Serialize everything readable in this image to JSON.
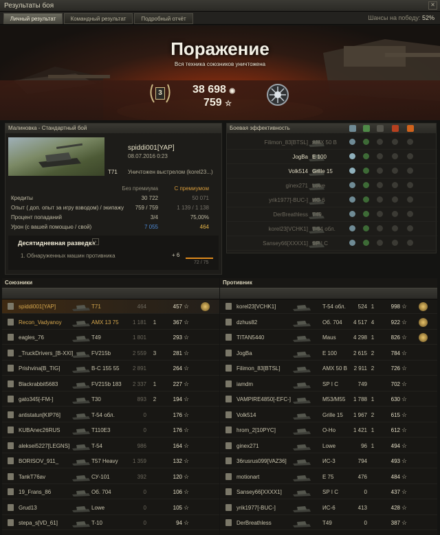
{
  "window": {
    "title": "Результаты боя",
    "close": "×"
  },
  "tabs": [
    {
      "label": "Личный результат",
      "active": true
    },
    {
      "label": "Командный результат",
      "active": false
    },
    {
      "label": "Подробный отчёт",
      "active": false
    }
  ],
  "chance": {
    "label": "Шансы на победу:",
    "value": "52%"
  },
  "banner": {
    "result": "Поражение",
    "subtitle": "Вся техника союзников уничтожена",
    "place": "3",
    "credits": "38 698",
    "xp": "759"
  },
  "battle": {
    "map_mode": "Малиновка - Стандартный бой",
    "player": "spiddi001[YAP]",
    "date": "08.07.2016 0:23",
    "tank": "T71",
    "death": "Уничтожен выстрелом (korel23...)"
  },
  "stats": {
    "col_basic": "Без премиума",
    "col_premium": "С премиумом",
    "rows": [
      {
        "label": "Кредиты",
        "basic": "30 722",
        "premium": "50 071"
      },
      {
        "label": "Опыт (    доп. опыт за игру взводом) / экипажу",
        "basic": "759 / 759",
        "premium": "1 139 / 1 138"
      },
      {
        "label": "Процент попаданий",
        "basic": "3/4",
        "premium": "75,00%"
      },
      {
        "label": "Урон (с вашей помощью / свой)",
        "basic": "7 055",
        "premium": "464"
      }
    ]
  },
  "scouting": {
    "title": "Десятидневная разведка",
    "quest": "1. Обнаруженных машин противника",
    "reward": "+ 6",
    "progress": "72 / 75",
    "progress_fraction": 0.96
  },
  "efficiency": {
    "title": "Боевая эффективность",
    "rows": [
      {
        "name": "Filimon_83[BTSL]",
        "tank": "AMX 50 B",
        "dim": true
      },
      {
        "name": "JogBa",
        "tank": "E 100",
        "dim": false
      },
      {
        "name": "Volk514",
        "tank": "Grille 15",
        "dim": false
      },
      {
        "name": "ginex271",
        "tank": "Lowe",
        "dim": true
      },
      {
        "name": "yrik1977[-BUC-]",
        "tank": "ИС-6",
        "dim": true
      },
      {
        "name": "DerBreathless",
        "tank": "T49",
        "dim": true
      },
      {
        "name": "korel23[VCHK1]",
        "tank": "T-54 обл.",
        "dim": true
      },
      {
        "name": "Sansey66[XXXX1]",
        "tank": "SP I C",
        "dim": true
      }
    ]
  },
  "allies": {
    "title": "Союзники",
    "rows": [
      {
        "name": "spiddi001[YAP]",
        "tank": "T71",
        "dmg": "464",
        "kills": "",
        "xp": "457",
        "me": true
      },
      {
        "name": "Recon_Vadyanoy",
        "tank": "AMX 13 75",
        "dmg": "1 181",
        "kills": "1",
        "xp": "367",
        "yellow": true
      },
      {
        "name": "eagles_76",
        "tank": "T49",
        "dmg": "1 801",
        "kills": "",
        "xp": "293"
      },
      {
        "name": "_TruckDrivers_[B-XXI]",
        "tank": "FV215b",
        "dmg": "2 559",
        "kills": "3",
        "xp": "281"
      },
      {
        "name": "Prishvina[B_TIG]",
        "tank": "B-C 155 55",
        "dmg": "2 891",
        "kills": "",
        "xp": "264"
      },
      {
        "name": "Blackrabbit5683",
        "tank": "FV215b 183",
        "dmg": "2 337",
        "kills": "1",
        "xp": "227"
      },
      {
        "name": "gato345[-FM-]",
        "tank": "T30",
        "dmg": "893",
        "kills": "2",
        "xp": "194"
      },
      {
        "name": "antistatun[KIP76]",
        "tank": "T-54 обл.",
        "dmg": "0",
        "kills": "",
        "xp": "176"
      },
      {
        "name": "KUBAnec26RUS",
        "tank": "T110E3",
        "dmg": "0",
        "kills": "",
        "xp": "176"
      },
      {
        "name": "aleksei5227[LEGNS]",
        "tank": "T-54",
        "dmg": "986",
        "kills": "",
        "xp": "164"
      },
      {
        "name": "BORISOV_911_",
        "tank": "T57 Heavy",
        "dmg": "1 359",
        "kills": "",
        "xp": "132"
      },
      {
        "name": "TankT76av",
        "tank": "СУ-101",
        "dmg": "392",
        "kills": "",
        "xp": "120"
      },
      {
        "name": "19_Frans_86",
        "tank": "Об. 704",
        "dmg": "0",
        "kills": "",
        "xp": "106"
      },
      {
        "name": "Grud13",
        "tank": "Lowe",
        "dmg": "0",
        "kills": "",
        "xp": "105"
      },
      {
        "name": "stepa_s[VD_61]",
        "tank": "T-10",
        "dmg": "0",
        "kills": "",
        "xp": "94"
      }
    ]
  },
  "enemies": {
    "title": "Противник",
    "rows": [
      {
        "name": "korel23[VCHK1]",
        "tank": "T-54 обл.",
        "dmg": "524",
        "kills": "1",
        "xp": "998"
      },
      {
        "name": "dzhus82",
        "tank": "Об. 704",
        "dmg": "4 517",
        "kills": "4",
        "xp": "922"
      },
      {
        "name": "TITAN5440",
        "tank": "Maus",
        "dmg": "4 298",
        "kills": "1",
        "xp": "826"
      },
      {
        "name": "JogBa",
        "tank": "E 100",
        "dmg": "2 615",
        "kills": "2",
        "xp": "784"
      },
      {
        "name": "Filimon_83[BTSL]",
        "tank": "AMX 50 B",
        "dmg": "2 911",
        "kills": "2",
        "xp": "726"
      },
      {
        "name": "iamdm",
        "tank": "SP I C",
        "dmg": "749",
        "kills": "",
        "xp": "702"
      },
      {
        "name": "VAMPIRE4850[-EFC-]",
        "tank": "M53/M55",
        "dmg": "1 788",
        "kills": "1",
        "xp": "630"
      },
      {
        "name": "Volk514",
        "tank": "Grille 15",
        "dmg": "1 967",
        "kills": "2",
        "xp": "615"
      },
      {
        "name": "hrom_2[10PYC]",
        "tank": "O-Ho",
        "dmg": "1 421",
        "kills": "1",
        "xp": "612"
      },
      {
        "name": "ginex271",
        "tank": "Lowe",
        "dmg": "96",
        "kills": "1",
        "xp": "494"
      },
      {
        "name": "36rusrus099[VAZ36]",
        "tank": "ИС-3",
        "dmg": "794",
        "kills": "",
        "xp": "493"
      },
      {
        "name": "motionart",
        "tank": "E 75",
        "dmg": "476",
        "kills": "",
        "xp": "484"
      },
      {
        "name": "Sansey66[XXXX1]",
        "tank": "SP I C",
        "dmg": "0",
        "kills": "",
        "xp": "437"
      },
      {
        "name": "yrik1977[-BUC-]",
        "tank": "ИС-6",
        "dmg": "413",
        "kills": "",
        "xp": "428"
      },
      {
        "name": "DerBreathless",
        "tank": "T49",
        "dmg": "0",
        "kills": "",
        "xp": "387"
      }
    ]
  },
  "colors": {
    "accent": "#d49a3b",
    "background": "#141412",
    "defeat_glow": "#c14f16"
  }
}
